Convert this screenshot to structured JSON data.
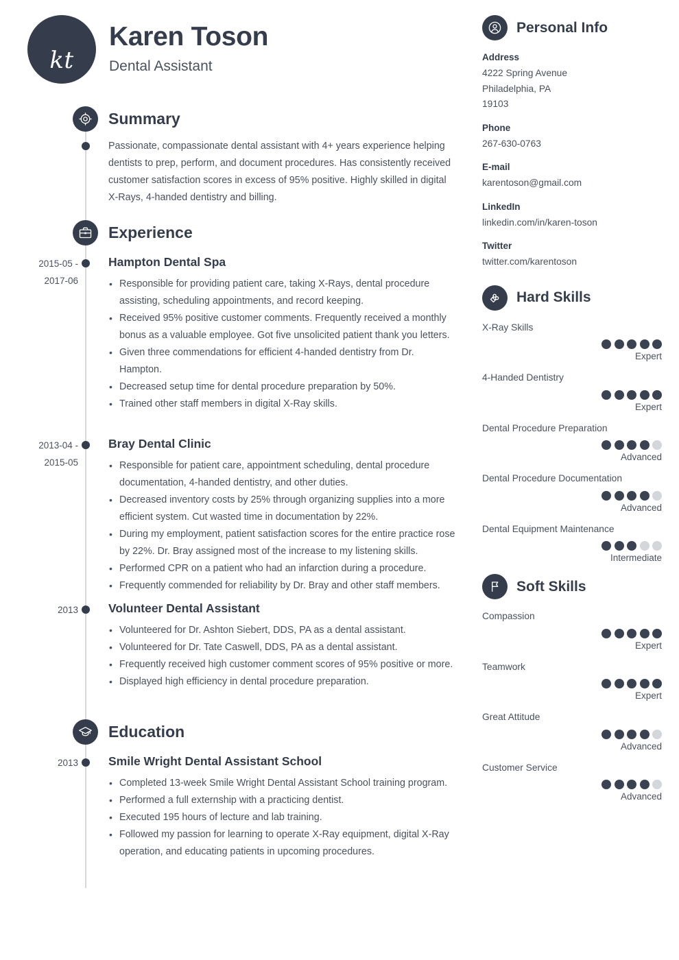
{
  "header": {
    "monogram": "kt",
    "name": "Karen Toson",
    "job_title": "Dental Assistant"
  },
  "sections": {
    "summary_title": "Summary",
    "experience_title": "Experience",
    "education_title": "Education"
  },
  "summary": {
    "text": "Passionate, compassionate dental assistant with 4+ years experience helping dentists to prep, perform, and document procedures. Has consistently received customer satisfaction scores in excess of 95% positive. Highly skilled in digital X-Rays, 4-handed dentistry and billing."
  },
  "experience": [
    {
      "date": "2015-05 - 2017-06",
      "title": "Hampton Dental Spa",
      "bullets": [
        "Responsible for providing patient care, taking X-Rays, dental procedure assisting, scheduling appointments, and record keeping.",
        "Received 95% positive customer comments. Frequently received a monthly bonus as a valuable employee. Got five unsolicited patient thank you letters.",
        "Given three commendations for efficient 4-handed dentistry from Dr. Hampton.",
        "Decreased setup time for dental procedure preparation by 50%.",
        "Trained other staff members in digital X-Ray skills."
      ]
    },
    {
      "date": "2013-04 - 2015-05",
      "title": "Bray Dental Clinic",
      "bullets": [
        "Responsible for patient care, appointment scheduling, dental procedure documentation, 4-handed dentistry, and other duties.",
        "Decreased inventory costs by 25% through organizing supplies into a more efficient system. Cut wasted time in documentation by 22%.",
        "During my employment, patient satisfaction scores for the entire practice rose by 22%. Dr. Bray assigned most of the increase to my listening skills.",
        "Performed CPR on a patient who had an infarction during a procedure.",
        "Frequently commended for reliability by Dr. Bray and other staff members."
      ]
    },
    {
      "date": "2013",
      "title": "Volunteer Dental Assistant",
      "bullets": [
        "Volunteered for Dr. Ashton Siebert, DDS, PA as a dental assistant.",
        "Volunteered for Dr. Tate Caswell, DDS, PA as a dental assistant.",
        "Frequently received high customer comment scores of 95% positive or more.",
        "Displayed high efficiency in dental procedure preparation."
      ]
    }
  ],
  "education": [
    {
      "date": "2013",
      "title": "Smile Wright Dental Assistant School",
      "bullets": [
        "Completed 13-week Smile Wright Dental Assistant School training program.",
        "Performed a full externship with a practicing dentist.",
        "Executed 195 hours of lecture and lab training.",
        "Followed my passion for learning to operate X-Ray equipment, digital X-Ray operation, and educating patients in upcoming procedures."
      ]
    }
  ],
  "personal_info": {
    "title": "Personal Info",
    "groups": [
      {
        "label": "Address",
        "lines": [
          "4222 Spring Avenue",
          "Philadelphia, PA",
          "19103"
        ]
      },
      {
        "label": "Phone",
        "lines": [
          "267-630-0763"
        ]
      },
      {
        "label": "E-mail",
        "lines": [
          "karentoson@gmail.com"
        ]
      },
      {
        "label": "LinkedIn",
        "lines": [
          "linkedin.com/in/karen-toson"
        ]
      },
      {
        "label": "Twitter",
        "lines": [
          "twitter.com/karentoson"
        ]
      }
    ]
  },
  "hard_skills": {
    "title": "Hard Skills",
    "max": 5,
    "items": [
      {
        "name": "X-Ray Skills",
        "rating": 5,
        "level": "Expert"
      },
      {
        "name": "4-Handed Dentistry",
        "rating": 5,
        "level": "Expert"
      },
      {
        "name": "Dental Procedure Preparation",
        "rating": 4,
        "level": "Advanced"
      },
      {
        "name": "Dental Procedure Documentation",
        "rating": 4,
        "level": "Advanced"
      },
      {
        "name": "Dental Equipment Maintenance",
        "rating": 3,
        "level": "Intermediate"
      }
    ]
  },
  "soft_skills": {
    "title": "Soft Skills",
    "max": 5,
    "items": [
      {
        "name": "Compassion",
        "rating": 5,
        "level": "Expert"
      },
      {
        "name": "Teamwork",
        "rating": 5,
        "level": "Expert"
      },
      {
        "name": "Great Attitude",
        "rating": 4,
        "level": "Advanced"
      },
      {
        "name": "Customer Service",
        "rating": 4,
        "level": "Advanced"
      }
    ]
  },
  "theme": {
    "dark": "#353d4c",
    "text": "#4a515e",
    "pip_off": "#d3d6da",
    "rail": "#d6d8dc"
  }
}
